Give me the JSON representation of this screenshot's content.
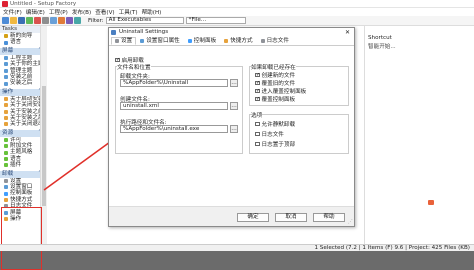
{
  "window": {
    "title": "Untitled - Setup Factory"
  },
  "menu": [
    "文件(F)",
    "编辑(E)",
    "工程(P)",
    "发布(B)",
    "查看(V)",
    "工具(T)",
    "帮助(H)"
  ],
  "toolbar": {
    "filter_label": "Filter:",
    "filter_value": "All Executables",
    "filter_text": "*File..."
  },
  "tasks": {
    "header": "Tasks",
    "top_items": [
      "新的向导",
      "语言"
    ],
    "sections": [
      {
        "title": "屏幕",
        "items": [
          "工程主题",
          "关于你的主题",
          "管理主题",
          "安装之前",
          "安装之后"
        ]
      },
      {
        "title": "操作",
        "items": [
          "关于启动安装",
          "关于关闭安装",
          "关于安装之前",
          "关于安装之后",
          "关于关闭退出"
        ]
      },
      {
        "title": "资源",
        "items": [
          "许可",
          "附加文件",
          "主题风格",
          "语言",
          "插件"
        ]
      },
      {
        "title": "卸载",
        "items": [
          "设置",
          "设置窗口",
          "控制面板",
          "快捷方式",
          "日志文件",
          "屏幕",
          "操作"
        ]
      }
    ]
  },
  "right_pane": {
    "header": "Shortcut",
    "value": "智能开始..."
  },
  "status": {
    "text": "1 Selected (7.2 | 1 Items (F) 9.6 | Project: 425 Files (KB)"
  },
  "dialog": {
    "title": "Uninstall Settings",
    "tabs": [
      "设置",
      "设置窗口属性",
      "控制面板",
      "快捷方式",
      "日志文件"
    ],
    "enable_uninstall": {
      "label": "启用卸载",
      "checked": true
    },
    "group_filenames": "文件名和位置",
    "fields": [
      {
        "label": "卸载文件夹:",
        "value": "%AppFolder%\\Uninstall"
      },
      {
        "label": "创建文件名:",
        "value": "uninstall.xml"
      },
      {
        "label": "执行路径和文件名:",
        "value": "%AppFolder%\\uninstall.exe"
      }
    ],
    "group_overwrite": "如果卸载已经存在",
    "overwrite_options": [
      {
        "label": "创建新的文件",
        "checked": true
      },
      {
        "label": "覆盖旧的文件",
        "checked": true
      },
      {
        "label": "进入覆盖控制面板",
        "checked": true
      },
      {
        "label": "覆盖控制面板",
        "checked": true
      }
    ],
    "group_options": "选项",
    "other_options": [
      {
        "label": "允许静默卸载",
        "checked": false
      },
      {
        "label": "日志文件",
        "checked": false
      },
      {
        "label": "日志置于顶部",
        "checked": false
      }
    ],
    "buttons": {
      "ok": "确定",
      "cancel": "取消",
      "help": "帮助"
    }
  },
  "colors": {
    "highlight_box": "#e0302a",
    "section_header": "#cfe0f2",
    "dialog_icon": "#4a7fc1"
  }
}
